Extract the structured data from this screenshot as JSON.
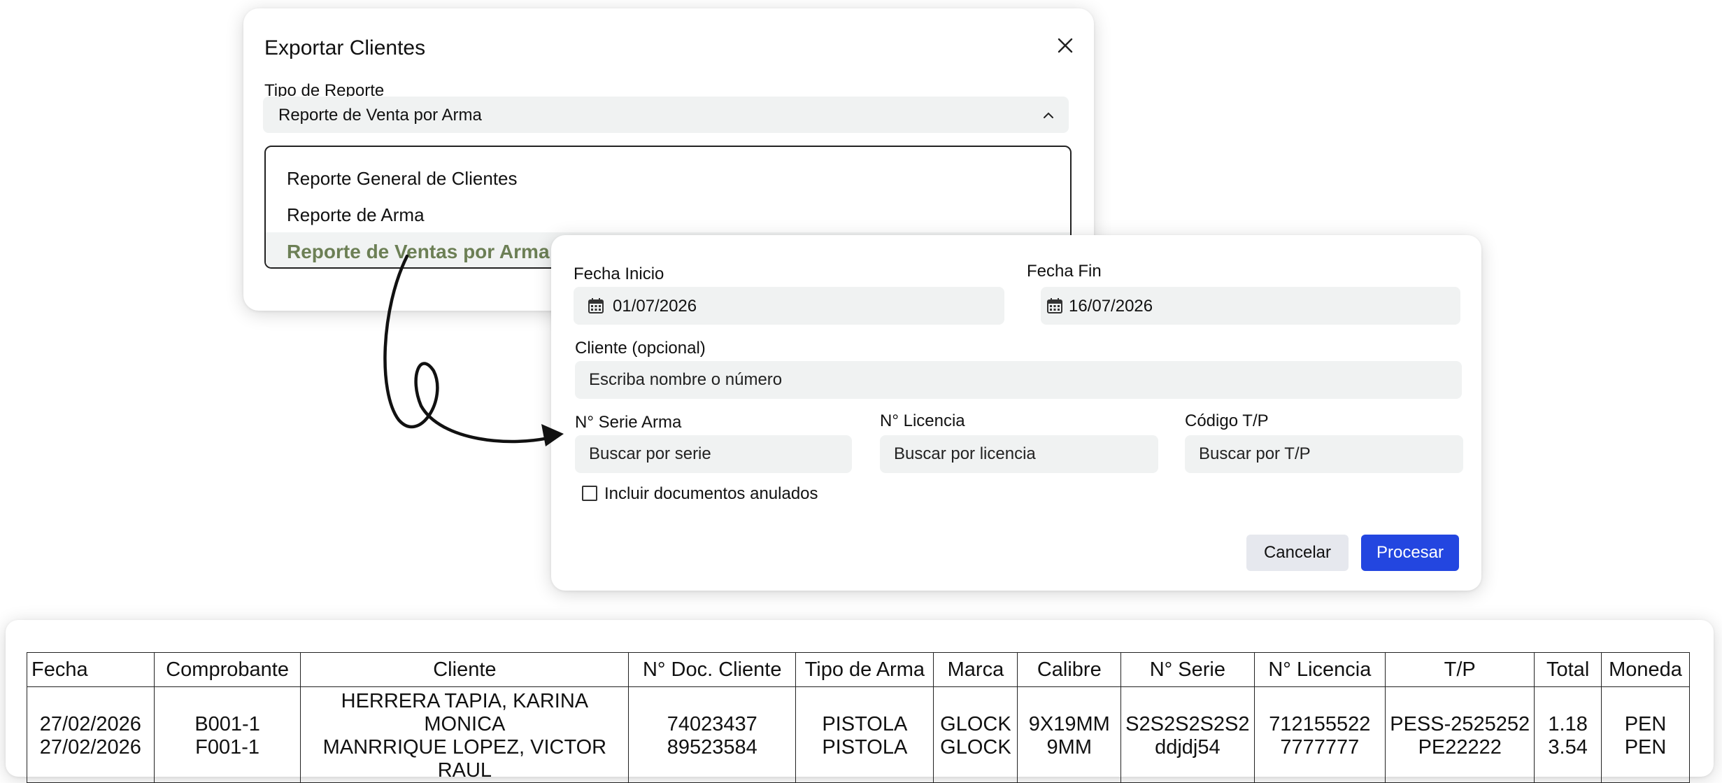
{
  "export_dialog": {
    "title": "Exportar Clientes",
    "report_type_label": "Tipo de Reporte",
    "selected_value": "Reporte de Venta por Arma",
    "options": [
      {
        "label": "Reporte General de Clientes",
        "selected": false
      },
      {
        "label": "Reporte de Arma",
        "selected": false
      },
      {
        "label": "Reporte de Ventas por Arma",
        "selected": true
      }
    ],
    "accent_color": "#6c7f55"
  },
  "filters_dialog": {
    "start_date_label": "Fecha Inicio",
    "start_date_value": "01/07/2026",
    "end_date_label": "Fecha Fin",
    "end_date_value": "16/07/2026",
    "client_label": "Cliente (opcional)",
    "client_placeholder": "Escriba nombre o número",
    "serial_label": "N° Serie Arma",
    "serial_placeholder": "Buscar por serie",
    "license_label": "N° Licencia",
    "license_placeholder": "Buscar por licencia",
    "tp_label": "Código T/P",
    "tp_placeholder": "Buscar por T/P",
    "include_void_label": "Incluir documentos anulados",
    "include_void_checked": false,
    "cancel_label": "Cancelar",
    "process_label": "Procesar",
    "primary_color": "#2346e0"
  },
  "report_table": {
    "columns": [
      "Fecha",
      "Comprobante",
      "Cliente",
      "N° Doc. Cliente",
      "Tipo de Arma",
      "Marca",
      "Calibre",
      "N° Serie",
      "N° Licencia",
      "T/P",
      "Total",
      "Moneda"
    ],
    "rows": [
      [
        "27/02/2026",
        "B001-1",
        "HERRERA TAPIA, KARINA MONICA",
        "74023437",
        "PISTOLA",
        "GLOCK",
        "9X19MM",
        "S2S2S2S2S2",
        "712155522",
        "PESS-2525252",
        "1.18",
        "PEN"
      ],
      [
        "27/02/2026",
        "F001-1",
        "MANRRIQUE LOPEZ, VICTOR RAUL",
        "89523584",
        "PISTOLA",
        "GLOCK",
        "9MM",
        "ddjdj54",
        "7777777",
        "PE22222",
        "3.54",
        "PEN"
      ]
    ]
  }
}
